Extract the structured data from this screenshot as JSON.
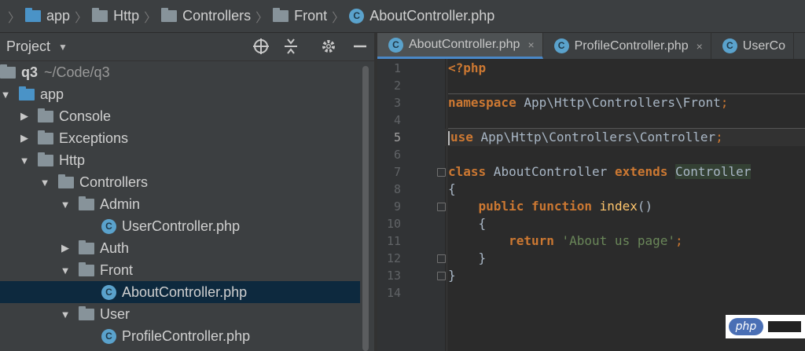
{
  "breadcrumb": {
    "items": [
      {
        "label": "app",
        "icon": "folder-icon"
      },
      {
        "label": "Http",
        "icon": "folder-icon"
      },
      {
        "label": "Controllers",
        "icon": "folder-icon"
      },
      {
        "label": "Front",
        "icon": "folder-icon"
      },
      {
        "label": "AboutController.php",
        "icon": "php-class-icon"
      }
    ],
    "separator": "〉"
  },
  "project_panel": {
    "title": "Project",
    "toolbar_icons": [
      "target-icon",
      "collapse-all-icon",
      "gear-icon",
      "minimize-icon"
    ],
    "tree": [
      {
        "label": "q3",
        "extra": "~/Code/q3",
        "icon": "folder-icon",
        "expanded": null,
        "bold": true
      },
      {
        "label": "app",
        "icon": "folder-icon",
        "expanded": true
      },
      {
        "label": "Console",
        "icon": "folder-icon",
        "expanded": false
      },
      {
        "label": "Exceptions",
        "icon": "folder-icon",
        "expanded": false
      },
      {
        "label": "Http",
        "icon": "folder-icon",
        "expanded": true
      },
      {
        "label": "Controllers",
        "icon": "folder-icon",
        "expanded": true
      },
      {
        "label": "Admin",
        "icon": "folder-icon",
        "expanded": true
      },
      {
        "label": "UserController.php",
        "icon": "php-class-icon"
      },
      {
        "label": "Auth",
        "icon": "folder-icon",
        "expanded": false
      },
      {
        "label": "Front",
        "icon": "folder-icon",
        "expanded": true
      },
      {
        "label": "AboutController.php",
        "icon": "php-class-icon",
        "selected": true
      },
      {
        "label": "User",
        "icon": "folder-icon",
        "expanded": true
      },
      {
        "label": "ProfileController.php",
        "icon": "php-class-icon"
      }
    ]
  },
  "editor": {
    "tabs": [
      {
        "label": "AboutController.php",
        "active": true,
        "close": "×"
      },
      {
        "label": "ProfileController.php",
        "active": false,
        "close": "×"
      },
      {
        "label": "UserCo",
        "active": false
      }
    ],
    "current_line": 5,
    "lines": [
      {
        "n": "1",
        "tokens": [
          {
            "t": "<?php",
            "c": "kw"
          }
        ]
      },
      {
        "n": "2",
        "tokens": []
      },
      {
        "n": "3",
        "tokens": [
          {
            "t": "namespace",
            "c": "kw"
          },
          {
            "t": " App\\Http\\Controllers\\Front",
            "c": ""
          },
          {
            "t": ";",
            "c": "kw2"
          }
        ]
      },
      {
        "n": "4",
        "tokens": []
      },
      {
        "n": "5",
        "tokens": [
          {
            "t": "use",
            "c": "kw"
          },
          {
            "t": " App\\Http\\Controllers\\Controller",
            "c": ""
          },
          {
            "t": ";",
            "c": "kw2"
          }
        ]
      },
      {
        "n": "6",
        "tokens": []
      },
      {
        "n": "7",
        "tokens": [
          {
            "t": "class",
            "c": "kw"
          },
          {
            "t": " AboutController ",
            "c": ""
          },
          {
            "t": "extends",
            "c": "kw"
          },
          {
            "t": " ",
            "c": ""
          },
          {
            "t": "Controller",
            "c": "cls-hl"
          }
        ]
      },
      {
        "n": "8",
        "tokens": [
          {
            "t": "{",
            "c": ""
          }
        ]
      },
      {
        "n": "9",
        "tokens": [
          {
            "t": "    ",
            "c": ""
          },
          {
            "t": "public",
            "c": "kw"
          },
          {
            "t": " ",
            "c": ""
          },
          {
            "t": "function",
            "c": "kw"
          },
          {
            "t": " ",
            "c": ""
          },
          {
            "t": "index",
            "c": "fn"
          },
          {
            "t": "()",
            "c": ""
          }
        ]
      },
      {
        "n": "10",
        "tokens": [
          {
            "t": "    {",
            "c": ""
          }
        ]
      },
      {
        "n": "11",
        "tokens": [
          {
            "t": "        ",
            "c": ""
          },
          {
            "t": "return",
            "c": "kw"
          },
          {
            "t": " ",
            "c": ""
          },
          {
            "t": "'About us page'",
            "c": "str"
          },
          {
            "t": ";",
            "c": "kw2"
          }
        ]
      },
      {
        "n": "12",
        "tokens": [
          {
            "t": "    }",
            "c": ""
          }
        ]
      },
      {
        "n": "13",
        "tokens": [
          {
            "t": "}",
            "c": ""
          }
        ]
      },
      {
        "n": "14",
        "tokens": []
      }
    ]
  },
  "watermark": {
    "logo_text": "php"
  },
  "colors": {
    "background": "#3c3f41",
    "editor_bg": "#2b2b2b",
    "keyword": "#cc7832",
    "string": "#6a8759",
    "function": "#ffc66d",
    "selection": "#0d293e",
    "active_tab_accent": "#4a88c7"
  }
}
